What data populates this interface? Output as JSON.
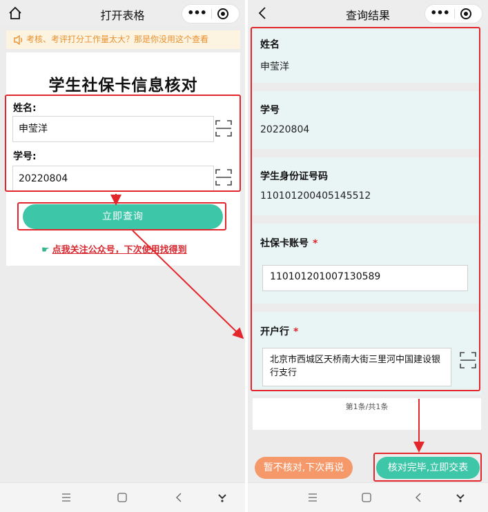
{
  "left": {
    "title": "打开表格",
    "notice": "考核、考评打分工作量太大？那是你没用这个查看",
    "form_title": "学生社保卡信息核对",
    "name_label": "姓名:",
    "name_value": "申莹洋",
    "id_label": "学号:",
    "id_value": "20220804",
    "query_button": "立即查询",
    "follow_link": "点我关注公众号，下次使用找得到"
  },
  "right": {
    "title": "查询结果",
    "fields": [
      {
        "label": "姓名",
        "value": "申莹洋"
      },
      {
        "label": "学号",
        "value": "20220804"
      },
      {
        "label": "学生身份证号码",
        "value": "110101200405145512"
      },
      {
        "label": "社保卡账号",
        "required_mark": "*",
        "value": "110101201007130589"
      },
      {
        "label": "开户行",
        "required_mark": "*",
        "value": "北京市西城区天桥南大街三里河中国建设银行支行"
      }
    ],
    "pager": "第1条/共1条",
    "skip_button": "暂不核对,下次再说",
    "done_button": "核对完毕,立即交表"
  },
  "icons": {
    "home": "home-icon",
    "back": "back-arrow-icon",
    "more": "more-dots-icon",
    "close": "target-close-icon",
    "scan": "scan-icon",
    "speaker": "speaker-icon",
    "hand": "pointing-hand-icon",
    "menu": "menu-icon",
    "square": "home-square-icon",
    "nav_back": "nav-back-icon",
    "down": "down-arrow-icon"
  },
  "colors": {
    "accent_green": "#3ec6a9",
    "accent_orange": "#f5996b",
    "highlight_red": "#e3262b",
    "link_red": "#d7282f",
    "notice_text": "#e9912f",
    "result_card_bg": "#e9f4f4"
  }
}
